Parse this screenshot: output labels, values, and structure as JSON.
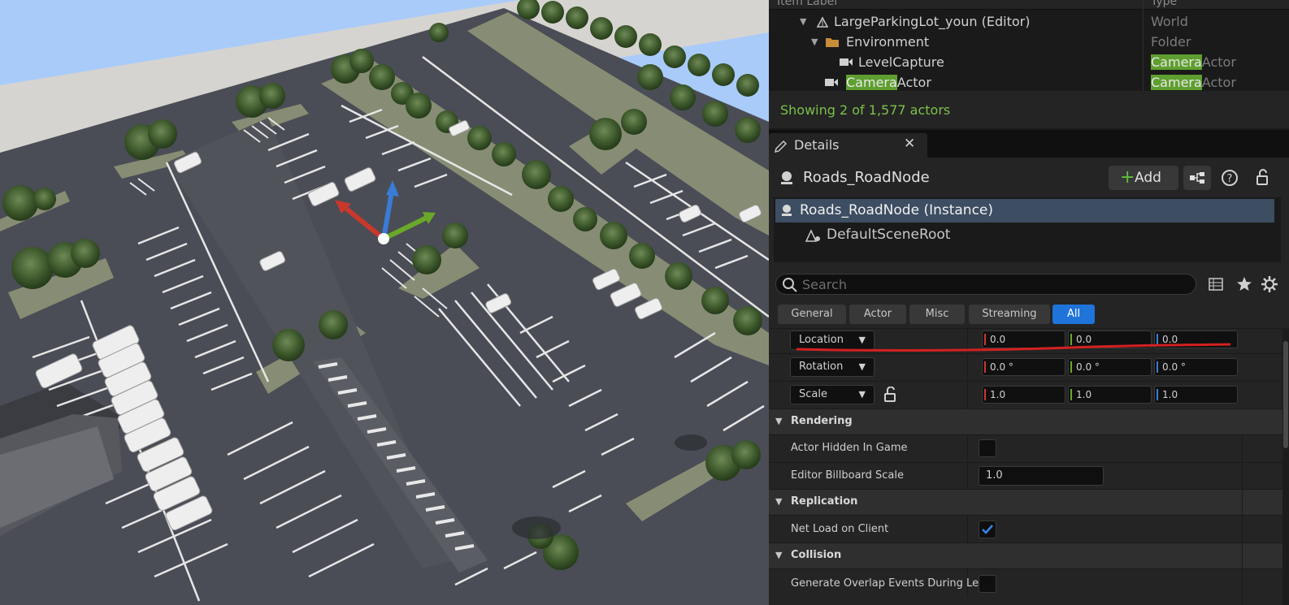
{
  "outliner": {
    "col_label": "Item Label",
    "col_type": "Type",
    "rows": [
      {
        "label": "LargeParkingLot_youn (Editor)",
        "type": "World"
      },
      {
        "label": "Environment",
        "type": "Folder"
      },
      {
        "label": "LevelCapture",
        "type_hl": "Camera",
        "type_rest": "Actor"
      },
      {
        "label_hl": "Camera",
        "label_rest": "Actor",
        "type_hl": "Camera",
        "type_rest": "Actor"
      }
    ],
    "status": "Showing 2 of 1,577 actors"
  },
  "details": {
    "tab_label": "Details",
    "tab_close": "✕",
    "actor_name": "Roads_RoadNode",
    "add_label": "Add",
    "components": {
      "root": "Roads_RoadNode (Instance)",
      "child": "DefaultSceneRoot"
    },
    "search_placeholder": "Search",
    "filters": [
      "General",
      "Actor",
      "Misc",
      "Streaming",
      "All"
    ],
    "transform": {
      "location": {
        "label": "Location",
        "x": "0.0",
        "y": "0.0",
        "z": "0.0"
      },
      "rotation": {
        "label": "Rotation",
        "x": "0.0 °",
        "y": "0.0 °",
        "z": "0.0 °"
      },
      "scale": {
        "label": "Scale",
        "x": "1.0",
        "y": "1.0",
        "z": "1.0"
      }
    },
    "rendering": {
      "title": "Rendering",
      "hidden_label": "Actor Hidden In Game",
      "hidden_checked": false,
      "billboard_label": "Editor Billboard Scale",
      "billboard_value": "1.0"
    },
    "replication": {
      "title": "Replication",
      "net_load_label": "Net Load on Client",
      "net_load_checked": true
    },
    "collision": {
      "title": "Collision",
      "overlap_label": "Generate Overlap Events During Lev..."
    }
  },
  "colors": {
    "accent_blue": "#1f74da",
    "highlight_green": "#5e9f2f",
    "status_green": "#7bc14a",
    "annotation_red": "#d42020",
    "axis_x": "#c8382c",
    "axis_y": "#6aa829",
    "axis_z": "#3a7bd5"
  }
}
